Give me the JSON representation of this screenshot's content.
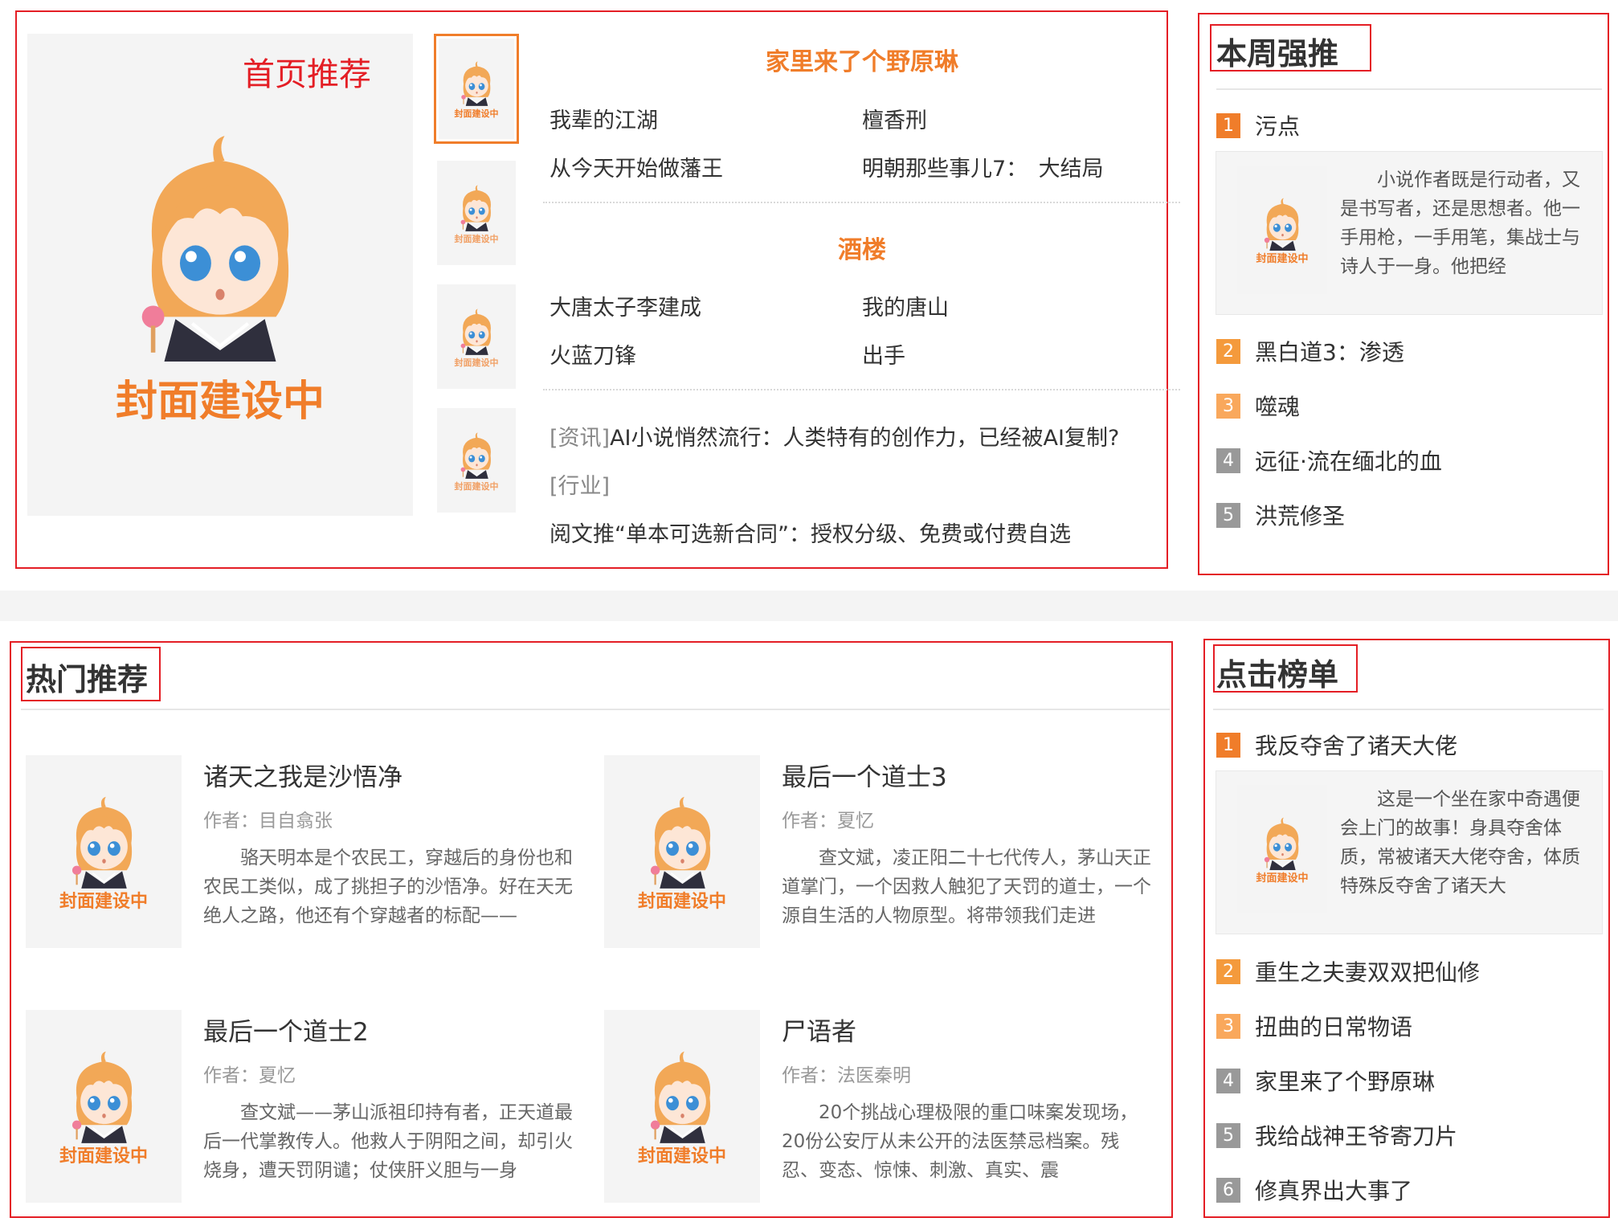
{
  "colors": {
    "accent": "#f07d2a",
    "highlight_border": "#e41e25",
    "rank_orange": "#f07d2a",
    "rank_light": "#f9a85c",
    "rank_gray": "#999999"
  },
  "cover_text": "封面建设中",
  "recommend": {
    "label": "首页推荐",
    "hot_title_1": "家里来了个野原琳",
    "links_1": [
      "我辈的江湖",
      "檀香刑",
      "从今天开始做藩王",
      "明朝那些事儿7：　大结局"
    ],
    "hot_title_2": "酒楼",
    "links_2": [
      "大唐太子李建成",
      "我的唐山",
      "火蓝刀锋",
      "出手"
    ],
    "news": [
      {
        "tag": "[资讯]",
        "text": "AI小说悄然流行：人类特有的创作力，已经被AI复制?"
      },
      {
        "tag": "[行业]",
        "text": ""
      },
      {
        "tag": "",
        "text": "阅文推“单本可选新合同”：授权分级、免费或付费自选"
      }
    ]
  },
  "weekly": {
    "title": "本周强推",
    "items": [
      "污点",
      "黑白道3：渗透",
      "噬魂",
      "远征·流在缅北的血",
      "洪荒修圣"
    ],
    "numbers": [
      "1",
      "2",
      "3",
      "4",
      "5"
    ],
    "card_desc": "小说作者既是行动者，又是书写者，还是思想者。他一手用枪，一手用笔，集战士与诗人于一身。他把经"
  },
  "hot": {
    "title": "热门推荐",
    "books": [
      {
        "title": "诸天之我是沙悟净",
        "author": "作者：目自翕张",
        "desc": "骆天明本是个农民工，穿越后的身份也和农民工类似，成了挑担子的沙悟净。好在天无绝人之路，他还有个穿越者的标配——"
      },
      {
        "title": "最后一个道士3",
        "author": "作者：夏忆",
        "desc": "查文斌，凌正阳二十七代传人，茅山天正道掌门，一个因救人触犯了天罚的道士，一个源自生活的人物原型。将带领我们走进"
      },
      {
        "title": "最后一个道士2",
        "author": "作者：夏忆",
        "desc": "查文斌——茅山派祖印持有者，正天道最后一代掌教传人。他救人于阴阳之间，却引火烧身，遭天罚阴谴；仗侠肝义胆与一身"
      },
      {
        "title": "尸语者",
        "author": "作者：法医秦明",
        "desc": "20个挑战心理极限的重口味案发现场，20份公安厅从未公开的法医禁忌档案。残忍、变态、惊悚、刺激、真实、震"
      }
    ]
  },
  "clicks": {
    "title": "点击榜单",
    "items": [
      "我反夺舍了诸天大佬",
      "重生之夫妻双双把仙修",
      "扭曲的日常物语",
      "家里来了个野原琳",
      "我给战神王爷寄刀片",
      "修真界出大事了"
    ],
    "numbers": [
      "1",
      "2",
      "3",
      "4",
      "5",
      "6"
    ],
    "card_desc": "这是一个坐在家中奇遇便会上门的故事！身具夺舍体质，常被诸天大佬夺舍，体质特殊反夺舍了诸天大"
  }
}
